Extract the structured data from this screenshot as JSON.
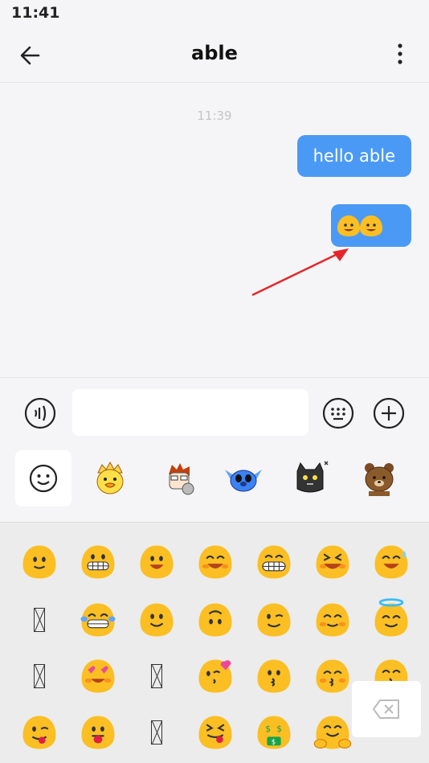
{
  "status": {
    "time": "11:41"
  },
  "header": {
    "title": "able"
  },
  "chat": {
    "timestamp": "11:39",
    "messages": [
      {
        "type": "text",
        "text": "hello able"
      },
      {
        "type": "emoji",
        "emojis": [
          "grinning-blob",
          "grinning-blob"
        ]
      }
    ]
  },
  "input": {
    "value": "",
    "placeholder": ""
  },
  "sticker_tabs": [
    "smiley-face-icon",
    "yellow-chick-sticker",
    "cartoon-boy-sticker",
    "stitch-sticker",
    "black-cat-sticker",
    "brown-bear-sticker"
  ],
  "emoji_grid": [
    [
      "slight-smile",
      "grin-teeth",
      "open-smile",
      "grin-blush",
      "big-grin",
      "squint-laugh",
      "sweat-smile"
    ],
    [
      "missing",
      "tears-of-joy",
      "smile",
      "upside-down",
      "wink",
      "smiling-eyes",
      "halo"
    ],
    [
      "missing",
      "heart-eyes",
      "missing",
      "kiss-heart",
      "kissing",
      "kissing-closed-eyes",
      "kissing-smile"
    ],
    [
      "wink-tongue",
      "tongue-out",
      "missing",
      "squint-tongue",
      "money-mouth",
      "hugging",
      "missing"
    ]
  ],
  "colors": {
    "accent": "#4a9af5",
    "emoji_yellow": "#fbbf24"
  }
}
